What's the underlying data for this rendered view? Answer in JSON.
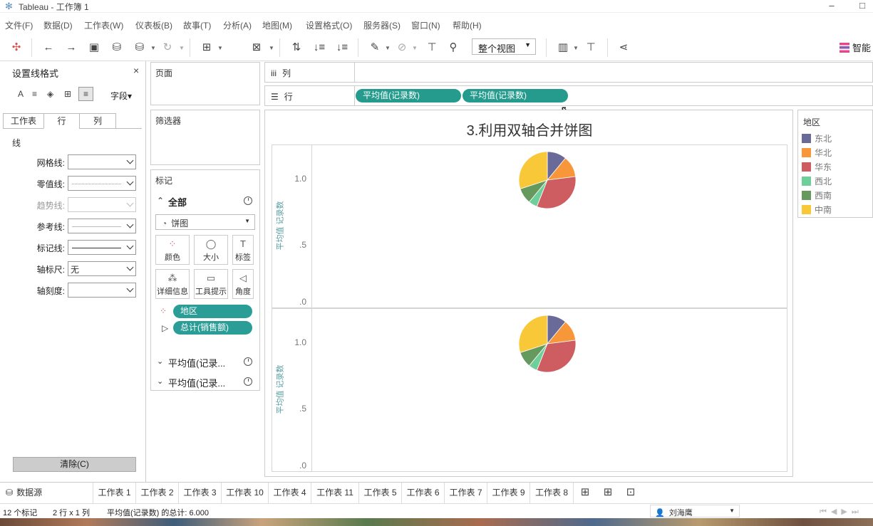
{
  "window": {
    "title": "Tableau - 工作簿 1",
    "minimize": "–",
    "maximize": "□"
  },
  "menu": [
    "文件(F)",
    "数据(D)",
    "工作表(W)",
    "仪表板(B)",
    "故事(T)",
    "分析(A)",
    "地图(M)",
    "设置格式(O)",
    "服务器(S)",
    "窗口(N)",
    "帮助(H)"
  ],
  "toolbar": {
    "view_select": "整个视图",
    "smart_label": "智能"
  },
  "format_pane": {
    "title": "设置线格式",
    "close": "×",
    "field_label": "字段▾",
    "tabs": [
      "工作表",
      "行",
      "列"
    ],
    "active_tab": 1,
    "section": "线",
    "rows": [
      {
        "label": "网格线:",
        "value": ""
      },
      {
        "label": "零值线:",
        "value": ""
      },
      {
        "label": "趋势线:",
        "value": ""
      },
      {
        "label": "参考线:",
        "value": ""
      },
      {
        "label": "标记线:",
        "value": ""
      },
      {
        "label": "轴标尺:",
        "value": "无"
      },
      {
        "label": "轴刻度:",
        "value": ""
      }
    ],
    "clear": "清除(C)"
  },
  "cards": {
    "pages": "页面",
    "filters": "筛选器",
    "marks": "标记",
    "all": "全部",
    "mark_type": "饼图",
    "buttons": [
      "颜色",
      "大小",
      "标签",
      "详细信息",
      "工具提示",
      "角度"
    ],
    "pills": [
      "地区",
      "总计(销售额)"
    ],
    "aggregates": [
      "平均值(记录...",
      "平均值(记录..."
    ]
  },
  "shelves": {
    "columns_label": "列",
    "rows_label": "行",
    "row_pills": [
      "平均值(记录数)",
      "平均值(记录数)"
    ]
  },
  "legend": {
    "title": "地区",
    "items": [
      {
        "name": "东北",
        "color": "#6a6a99"
      },
      {
        "name": "华北",
        "color": "#f7973a"
      },
      {
        "name": "华东",
        "color": "#cd5d60"
      },
      {
        "name": "西北",
        "color": "#6fcf9a"
      },
      {
        "name": "西南",
        "color": "#66995e"
      },
      {
        "name": "中南",
        "color": "#f8c839"
      }
    ]
  },
  "chart_data": {
    "type": "pie",
    "title": "3.利用双轴合并饼图",
    "ylabel": "平均值 记录数",
    "y_ticks": [
      "1.0",
      ".5",
      ".0"
    ],
    "ylim": [
      0,
      1.2
    ],
    "panes": 2,
    "categories": [
      "东北",
      "华北",
      "华东",
      "西北",
      "西南",
      "中南"
    ],
    "values": [
      0.11,
      0.12,
      0.33,
      0.05,
      0.09,
      0.3
    ],
    "y_value": 1.0
  },
  "sheet_tabs": [
    "数据源",
    "工作表 1",
    "工作表 2",
    "工作表 3",
    "工作表 10",
    "工作表 4",
    "工作表 11",
    "工作表 5",
    "工作表 6",
    "工作表 7",
    "工作表 9",
    "工作表 8"
  ],
  "status": {
    "marks": "12 个标记",
    "dims": "2 行 x 1 列",
    "sum": "平均值(记录数) 的总计: 6.000",
    "user": "刘海鹰"
  }
}
